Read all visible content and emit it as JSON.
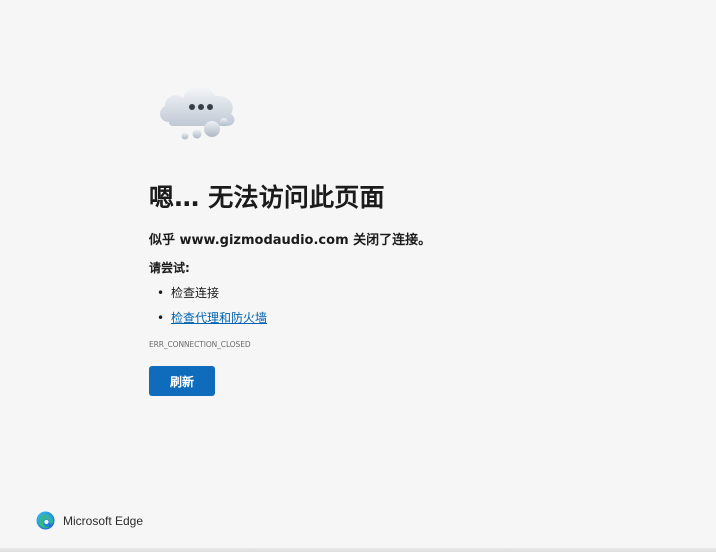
{
  "error": {
    "title": "嗯… 无法访问此页面",
    "subtitle": "似乎 www.gizmodaudio.com 关闭了连接。",
    "try_heading": "请尝试:",
    "suggestions": [
      {
        "label": "检查连接",
        "is_link": false
      },
      {
        "label": "检查代理和防火墙",
        "is_link": true
      }
    ],
    "code": "ERR_CONNECTION_CLOSED",
    "refresh_label": "刷新"
  },
  "brand": {
    "name": "Microsoft Edge",
    "icon": "edge-logo-icon"
  },
  "icons": {
    "illustration": "cloud-ellipsis-icon"
  },
  "colors": {
    "background": "#f6f6f6",
    "primary_button": "#0f6cbd",
    "link": "#0063b1"
  }
}
